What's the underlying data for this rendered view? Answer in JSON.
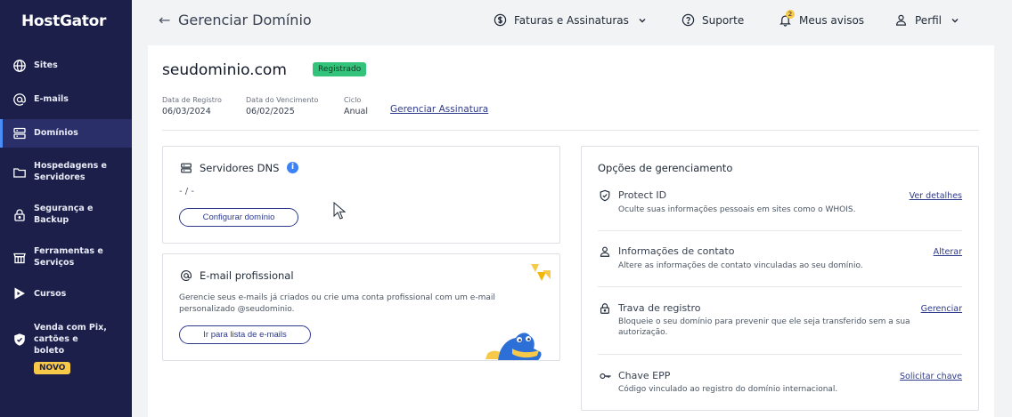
{
  "sidebar": {
    "logo": "HostGator",
    "items": [
      {
        "label": "Sites",
        "icon": "globe-icon"
      },
      {
        "label": "E-mails",
        "icon": "at-icon"
      },
      {
        "label": "Domínios",
        "icon": "server-icon",
        "active": true
      },
      {
        "label": "Hospedagens e Servidores",
        "icon": "folder-icon"
      },
      {
        "label": "Segurança e Backup",
        "icon": "lock-icon"
      },
      {
        "label": "Ferramentas e Serviços",
        "icon": "store-icon"
      },
      {
        "label": "Cursos",
        "icon": "play-icon"
      },
      {
        "label": "Venda com Pix, cartões e boleto",
        "icon": "shield-icon",
        "badge": "NOVO"
      }
    ]
  },
  "header": {
    "back_icon": "←",
    "title": "Gerenciar Domínio",
    "billing": "Faturas e Assinaturas",
    "support": "Suporte",
    "notices": "Meus avisos",
    "notices_count": "2",
    "profile": "Perfil"
  },
  "domain": {
    "name": "seudominio.com",
    "status": "Registrado",
    "registration_label": "Data de Registro",
    "registration_date": "06/03/2024",
    "expiry_label": "Data do Vencimento",
    "expiry_date": "06/02/2025",
    "cycle_label": "Ciclo",
    "cycle_value": "Anual",
    "manage_subscription": "Gerenciar Assinatura"
  },
  "dns_card": {
    "title": "Servidores DNS",
    "value": "- / -",
    "button": "Configurar domínio"
  },
  "email_card": {
    "title": "E-mail profissional",
    "description": "Gerencie seus e-mails já criados ou crie uma conta profissional com um e-mail personalizado @seudominio.",
    "button": "Ir para lista de e-mails"
  },
  "options": {
    "title": "Opções de gerenciamento",
    "items": [
      {
        "title": "Protect ID",
        "desc": "Oculte suas informações pessoais em sites como o WHOIS.",
        "link": "Ver detalhes",
        "icon": "shield-check-icon"
      },
      {
        "title": "Informações de contato",
        "desc": "Altere as informações de contato vinculadas ao seu domínio.",
        "link": "Alterar",
        "icon": "user-icon"
      },
      {
        "title": "Trava de registro",
        "desc": "Bloqueie o seu domínio para prevenir que ele seja transferido sem a sua autorização.",
        "link": "Gerenciar",
        "icon": "lock-icon"
      },
      {
        "title": "Chave EPP",
        "desc": "Código vinculado ao registro do domínio internacional.",
        "link": "Solicitar chave",
        "icon": "key-icon"
      }
    ]
  },
  "colors": {
    "sidebar_bg": "#1c1f4a",
    "accent": "#2d3a8c",
    "status_green": "#34c37a",
    "badge_yellow": "#f7c948"
  }
}
